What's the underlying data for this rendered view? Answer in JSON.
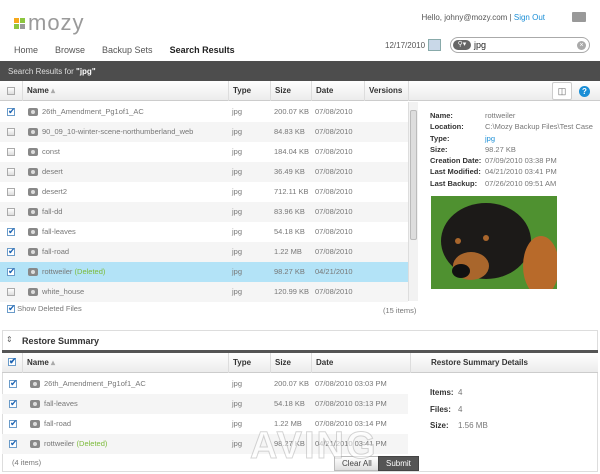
{
  "header": {
    "logo": "mozy",
    "greeting": "Hello, johny@mozy.com",
    "separator": "|",
    "sign_out": "Sign Out",
    "nav": [
      "Home",
      "Browse",
      "Backup Sets",
      "Search Results"
    ],
    "active_nav": "Search Results",
    "date": "12/17/2010",
    "search_value": "jpg"
  },
  "colors": {
    "accent": "#1a8ed6",
    "dark_bar": "#4d4d4d",
    "selected_row": "#b3e3f7",
    "deleted": "#7cbb3a",
    "logo": [
      "#f6a81b",
      "#8cc63f",
      "#8cc63f",
      "#9a9a9a"
    ]
  },
  "results": {
    "bar_prefix": "Search Results for ",
    "bar_query": "\"jpg\"",
    "columns": [
      "Name",
      "Type",
      "Size",
      "Date",
      "Versions"
    ],
    "rows": [
      {
        "name": "26th_Amendment_Pg1of1_AC",
        "type": "jpg",
        "size": "200.07 KB",
        "date": "07/08/2010",
        "checked": true
      },
      {
        "name": "90_09_10-winter-scene-northumberland_web",
        "type": "jpg",
        "size": "84.83 KB",
        "date": "07/08/2010",
        "checked": false
      },
      {
        "name": "const",
        "type": "jpg",
        "size": "184.04 KB",
        "date": "07/08/2010",
        "checked": false
      },
      {
        "name": "desert",
        "type": "jpg",
        "size": "36.49 KB",
        "date": "07/08/2010",
        "checked": false
      },
      {
        "name": "desert2",
        "type": "jpg",
        "size": "712.11 KB",
        "date": "07/08/2010",
        "checked": false
      },
      {
        "name": "fall-dd",
        "type": "jpg",
        "size": "83.96 KB",
        "date": "07/08/2010",
        "checked": false
      },
      {
        "name": "fall-leaves",
        "type": "jpg",
        "size": "54.18 KB",
        "date": "07/08/2010",
        "checked": true
      },
      {
        "name": "fall-road",
        "type": "jpg",
        "size": "1.22 MB",
        "date": "07/08/2010",
        "checked": true
      },
      {
        "name": "rottweiler",
        "deleted": "(Deleted)",
        "type": "jpg",
        "size": "98.27 KB",
        "date": "04/21/2010",
        "checked": true,
        "selected": true
      },
      {
        "name": "white_house",
        "type": "jpg",
        "size": "120.99 KB",
        "date": "07/08/2010",
        "checked": false
      }
    ],
    "show_deleted": "Show Deleted Files",
    "count": "(15 items)"
  },
  "details": {
    "labels": [
      "Name:",
      "Location:",
      "Type:",
      "Size:",
      "Creation Date:",
      "Last Modified:",
      "Last Backup:"
    ],
    "values": [
      "rottweiler",
      "C:\\Mozy Backup Files\\Test Case",
      "jpg",
      "98.27 KB",
      "07/09/2010 03:38 PM",
      "04/21/2010 03:41 PM",
      "07/26/2010 09:51 AM"
    ]
  },
  "restore": {
    "title": "Restore Summary",
    "columns": [
      "Name",
      "Type",
      "Size",
      "Date"
    ],
    "details_title": "Restore Summary Details",
    "rows": [
      {
        "name": "26th_Amendment_Pg1of1_AC",
        "type": "jpg",
        "size": "200.07 KB",
        "date": "07/08/2010 03:03 PM"
      },
      {
        "name": "fall-leaves",
        "type": "jpg",
        "size": "54.18 KB",
        "date": "07/08/2010 03:13 PM"
      },
      {
        "name": "fall-road",
        "type": "jpg",
        "size": "1.22 MB",
        "date": "07/08/2010 03:14 PM"
      },
      {
        "name": "rottweiler",
        "deleted": "(Deleted)",
        "type": "jpg",
        "size": "98.27 KB",
        "date": "04/21/2010 03:41 PM"
      }
    ],
    "summary": [
      {
        "label": "Items:",
        "value": "4"
      },
      {
        "label": "Files:",
        "value": "4"
      },
      {
        "label": "Size:",
        "value": "1.56 MB"
      }
    ],
    "count": "(4 items)",
    "clear_all": "Clear All",
    "submit": "Submit"
  },
  "watermark": "AVING news network"
}
